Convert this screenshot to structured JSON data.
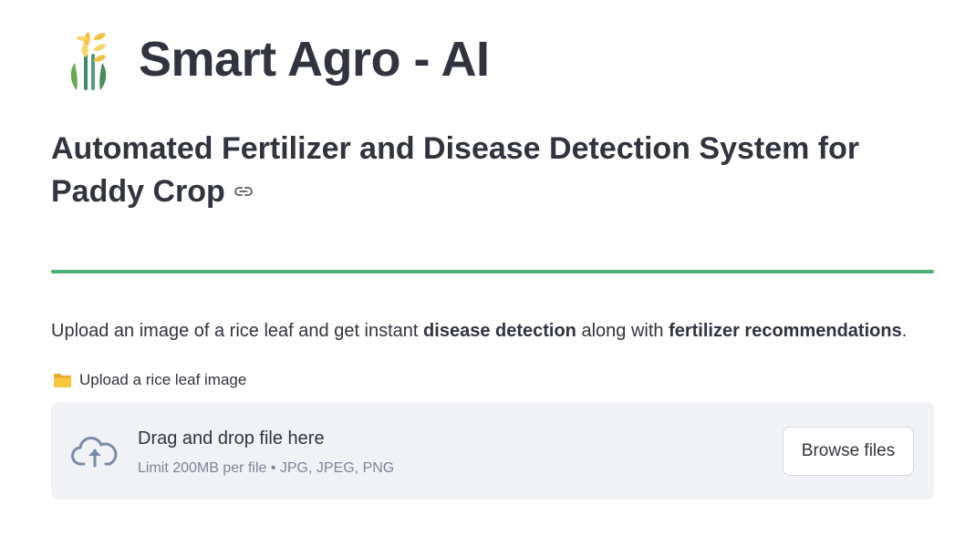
{
  "app": {
    "title": "Smart Agro - AI",
    "logo_icon": "wheat-sprout-icon"
  },
  "header": {
    "subtitle": "Automated Fertilizer and Disease Detection System for Paddy Crop",
    "anchor_icon": "link-icon"
  },
  "divider": {
    "color": "#4caf78"
  },
  "intro": {
    "prefix": "Upload an image of a rice leaf and get instant ",
    "bold1": "disease detection",
    "middle": " along with ",
    "bold2": "fertilizer recommendations",
    "suffix": "."
  },
  "uploader": {
    "label": "Upload a rice leaf image",
    "label_icon": "folder-icon",
    "drop_text": "Drag and drop file here",
    "limit_text": "Limit 200MB per file • JPG, JPEG, PNG",
    "upload_icon": "cloud-upload-icon",
    "browse_label": "Browse files"
  },
  "colors": {
    "text": "#31333f",
    "muted": "#808495",
    "dropzone_bg": "#f0f2f6",
    "accent_green": "#4caf78"
  }
}
